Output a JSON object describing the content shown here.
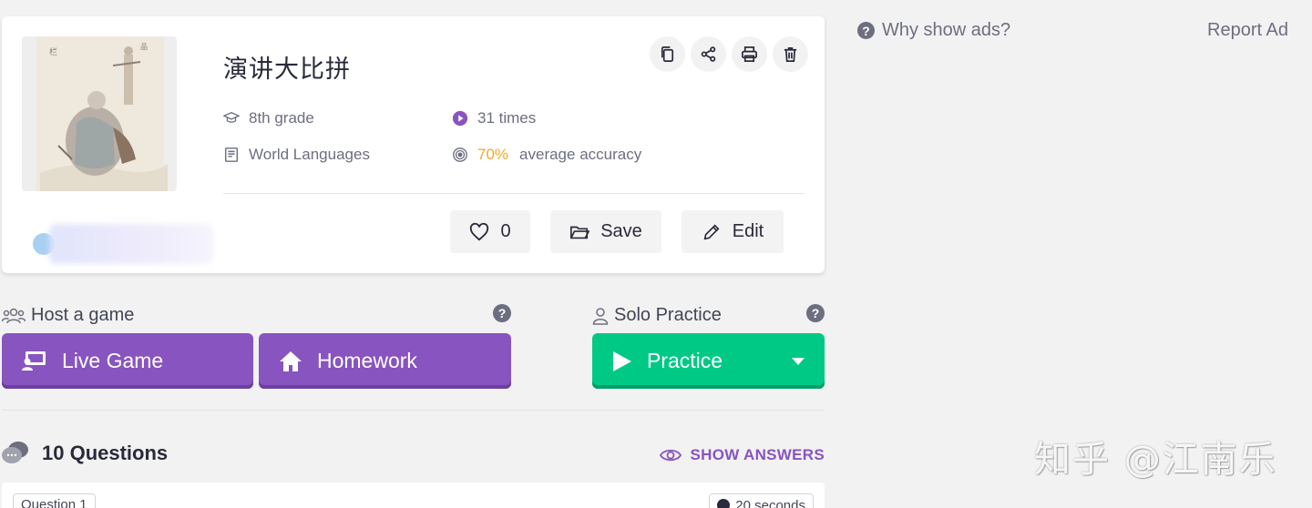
{
  "quiz": {
    "title": "演讲大比拼",
    "grade": "8th grade",
    "subject": "World Languages",
    "plays": "31 times",
    "accuracy_value": "70%",
    "accuracy_label": "average accuracy"
  },
  "actions": {
    "like_count": "0",
    "save_label": "Save",
    "edit_label": "Edit"
  },
  "host": {
    "label": "Host a game",
    "live_label": "Live Game",
    "homework_label": "Homework"
  },
  "solo": {
    "label": "Solo Practice",
    "practice_label": "Practice"
  },
  "questions": {
    "count_label": "10 Questions",
    "show_answers": "SHOW ANSWERS",
    "first_tag": "Question 1",
    "first_time": "20 seconds"
  },
  "ads": {
    "why": "Why show ads?",
    "report": "Report Ad"
  },
  "watermark": "知乎 @江南乐",
  "colors": {
    "primary": "#8854c0",
    "practice": "#00c985",
    "accuracy": "#efa929"
  },
  "icons": [
    "copy-icon",
    "share-icon",
    "print-icon",
    "delete-icon",
    "grad-cap-icon",
    "book-icon",
    "play-circle-icon",
    "target-icon",
    "heart-icon",
    "folder-icon",
    "pencil-icon",
    "users-icon",
    "user-icon",
    "help-icon",
    "projector-icon",
    "home-icon",
    "play-icon",
    "caret-down-icon",
    "speech-bubble-icon",
    "eye-icon",
    "clock-icon"
  ]
}
